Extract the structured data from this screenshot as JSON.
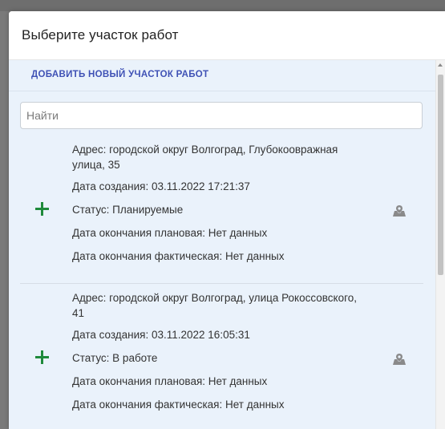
{
  "dialog": {
    "title": "Выберите участок работ"
  },
  "toolbar": {
    "add_label": "ДОБАВИТЬ НОВЫЙ УЧАСТОК РАБОТ"
  },
  "search": {
    "placeholder": "Найти",
    "value": ""
  },
  "sites": [
    {
      "address": "Адрес: городской округ Волгоград, Глубокоовражная улица, 35",
      "created": "Дата создания: 03.11.2022 17:21:37",
      "status": "Статус: Планируемые",
      "planned_end": "Дата окончания плановая: Нет данных",
      "actual_end": "Дата окончания фактическая: Нет данных",
      "add_icon": "plus-icon",
      "map_icon": "map-marker-icon"
    },
    {
      "address": "Адрес: городской округ Волгоград, улица Рокоссовского, 41",
      "created": "Дата создания: 03.11.2022 16:05:31",
      "status": "Статус: В работе",
      "planned_end": "Дата окончания плановая: Нет данных",
      "actual_end": "Дата окончания фактическая: Нет данных",
      "add_icon": "plus-icon",
      "map_icon": "map-marker-icon"
    }
  ],
  "colors": {
    "accent": "#3f51b5",
    "add_green": "#1f8a3b",
    "list_background": "#eaf2fb",
    "icon_gray": "#8a8a8a"
  }
}
